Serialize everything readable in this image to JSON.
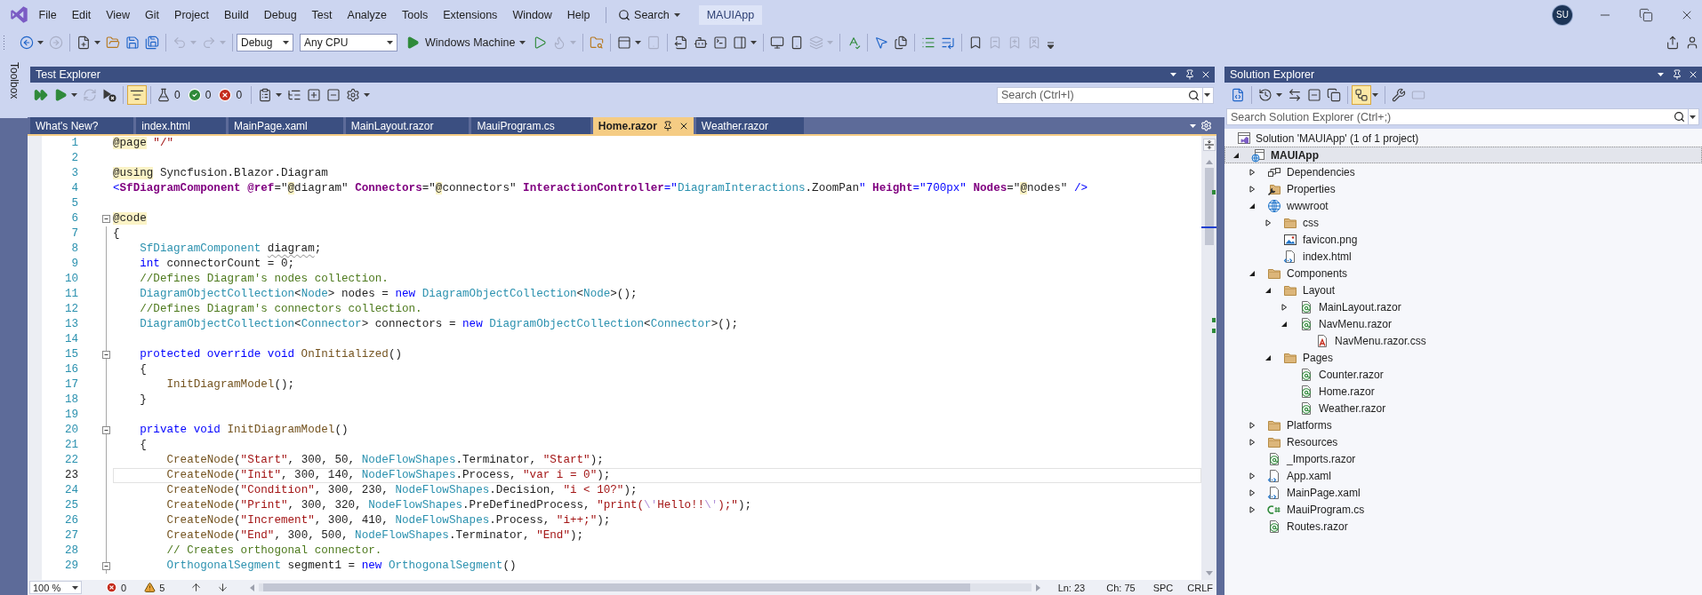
{
  "menu_bar": {
    "items": [
      "File",
      "Edit",
      "View",
      "Git",
      "Project",
      "Build",
      "Debug",
      "Test",
      "Analyze",
      "Tools",
      "Extensions",
      "Window",
      "Help"
    ],
    "search": "Search",
    "solution_name": "MAUIApp",
    "account_initials": "SU"
  },
  "main_toolbar": {
    "items": [
      {
        "kind": "icon",
        "disabled": false
      },
      {
        "kind": "icon",
        "disabled": true
      },
      {
        "kind": "separator"
      },
      {
        "kind": "icon",
        "disabled": false
      },
      {
        "kind": "icon",
        "disabled": false
      },
      {
        "kind": "icon",
        "disabled": false
      },
      {
        "kind": "icon",
        "disabled": false
      },
      {
        "kind": "separator"
      },
      {
        "kind": "icon",
        "disabled": true
      },
      {
        "kind": "icon",
        "disabled": true
      },
      {
        "kind": "separator"
      },
      {
        "kind": "select",
        "value": "Debug"
      },
      {
        "kind": "select",
        "value": "Any CPU"
      },
      {
        "kind": "launch",
        "label": "Windows Machine"
      },
      {
        "kind": "icon",
        "disabled": false
      },
      {
        "kind": "icon",
        "disabled": true
      },
      {
        "kind": "separator"
      },
      {
        "kind": "icon",
        "disabled": false
      },
      {
        "kind": "separator"
      },
      {
        "kind": "icon",
        "disabled": false
      },
      {
        "kind": "icon",
        "disabled": true
      },
      {
        "kind": "separator"
      },
      {
        "kind": "icon",
        "disabled": false
      },
      {
        "kind": "icon",
        "disabled": false
      },
      {
        "kind": "icon",
        "disabled": false
      },
      {
        "kind": "icon",
        "disabled": false
      },
      {
        "kind": "separator"
      },
      {
        "kind": "icon",
        "disabled": false
      },
      {
        "kind": "icon",
        "disabled": false
      },
      {
        "kind": "icon",
        "disabled": true
      },
      {
        "kind": "separator"
      },
      {
        "kind": "icon",
        "disabled": false
      },
      {
        "kind": "separator"
      },
      {
        "kind": "icon",
        "disabled": false
      },
      {
        "kind": "icon",
        "disabled": false
      },
      {
        "kind": "separator"
      },
      {
        "kind": "icon",
        "disabled": false
      },
      {
        "kind": "icon",
        "disabled": false
      },
      {
        "kind": "separator"
      },
      {
        "kind": "icon",
        "disabled": false
      },
      {
        "kind": "icon",
        "disabled": true
      },
      {
        "kind": "icon",
        "disabled": true
      },
      {
        "kind": "icon",
        "disabled": true
      }
    ],
    "right_items": [
      {
        "kind": "icon",
        "disabled": false
      },
      {
        "kind": "icon",
        "disabled": false
      }
    ]
  },
  "toolbox_tab": {
    "label": "Toolbox"
  },
  "test_explorer": {
    "title": "Test Explorer",
    "toolbar": [
      {
        "kind": "icon",
        "disabled": false,
        "on": false
      },
      {
        "kind": "icon",
        "disabled": false,
        "on": false
      },
      {
        "kind": "icon",
        "disabled": true,
        "on": false
      },
      {
        "kind": "icon",
        "disabled": false,
        "on": false
      },
      {
        "kind": "separator"
      },
      {
        "kind": "icon",
        "disabled": false,
        "on": true
      },
      {
        "kind": "separator"
      },
      {
        "kind": "counter",
        "value": "0"
      },
      {
        "kind": "counter",
        "value": "0"
      },
      {
        "kind": "counter",
        "value": "0"
      },
      {
        "kind": "separator"
      },
      {
        "kind": "icon",
        "disabled": false,
        "on": false
      },
      {
        "kind": "icon",
        "disabled": false,
        "on": false
      },
      {
        "kind": "icon",
        "disabled": false,
        "on": false
      },
      {
        "kind": "icon",
        "disabled": false,
        "on": false
      },
      {
        "kind": "icon",
        "disabled": false,
        "on": false
      }
    ],
    "search": {
      "placeholder": "Search (Ctrl+I)"
    }
  },
  "editor": {
    "tabs": [
      {
        "label": "What's New?",
        "selected": false
      },
      {
        "label": "index.html",
        "selected": false
      },
      {
        "label": "MainPage.xaml",
        "selected": false
      },
      {
        "label": "MainLayout.razor",
        "selected": false
      },
      {
        "label": "MauiProgram.cs",
        "selected": false
      },
      {
        "label": "Home.razor",
        "selected": true
      },
      {
        "label": "Weather.razor",
        "selected": false
      }
    ],
    "lines": [
      {
        "number": "1",
        "selected": false,
        "tokens": [
          {
            "kind": "razor",
            "text": "@page"
          },
          {
            "kind": "string",
            "text": " \"/\""
          }
        ]
      },
      {
        "number": "2",
        "selected": false
      },
      {
        "number": "3",
        "selected": false,
        "tokens": [
          {
            "kind": "razor",
            "text": "@using"
          },
          {
            "kind": "plain",
            "text": " Syncfusion.Blazor.Diagram"
          }
        ]
      },
      {
        "number": "4",
        "selected": false,
        "tokens": [
          {
            "kind": "punct",
            "text": "<"
          },
          {
            "kind": "markup",
            "text": "SfDiagramComponent"
          },
          {
            "kind": "markup",
            "text": " @ref"
          },
          {
            "kind": "plain",
            "text": "=\""
          },
          {
            "kind": "razor",
            "text": "@"
          },
          {
            "kind": "plain",
            "text": "diagram\" "
          },
          {
            "kind": "markup",
            "text": "Connectors"
          },
          {
            "kind": "plain",
            "text": "=\""
          },
          {
            "kind": "razor",
            "text": "@"
          },
          {
            "kind": "plain",
            "text": "connectors\" "
          },
          {
            "kind": "markup",
            "text": "InteractionController"
          },
          {
            "kind": "punct",
            "text": "=\""
          },
          {
            "kind": "type",
            "text": "DiagramInteractions"
          },
          {
            "kind": "plain",
            "text": ".ZoomPan"
          },
          {
            "kind": "punct",
            "text": "\""
          },
          {
            "kind": "markup",
            "text": " Height"
          },
          {
            "kind": "punct",
            "text": "=\"700px\""
          },
          {
            "kind": "markup",
            "text": " Nodes"
          },
          {
            "kind": "plain",
            "text": "=\""
          },
          {
            "kind": "razor",
            "text": "@"
          },
          {
            "kind": "plain",
            "text": "nodes\""
          },
          {
            "kind": "punct",
            "text": " />"
          }
        ]
      },
      {
        "number": "5",
        "selected": false
      },
      {
        "number": "6",
        "selected": false,
        "expanded": true,
        "tokens": [
          {
            "kind": "razor",
            "text": "@code"
          }
        ]
      },
      {
        "number": "7",
        "selected": false,
        "tokens": [
          {
            "kind": "plain",
            "text": "{"
          }
        ]
      },
      {
        "number": "8",
        "selected": false,
        "tokens": [
          {
            "kind": "type",
            "text": "    SfDiagramComponent "
          },
          {
            "kind": "flagged",
            "text": "diagram"
          },
          {
            "kind": "plain",
            "text": ";"
          }
        ]
      },
      {
        "number": "9",
        "selected": false,
        "tokens": [
          {
            "kind": "keyword",
            "text": "    int"
          },
          {
            "kind": "plain",
            "text": " connectorCount = 0;"
          }
        ]
      },
      {
        "number": "10",
        "selected": false,
        "tokens": [
          {
            "kind": "comment",
            "text": "    //Defines Diagram's nodes collection."
          }
        ]
      },
      {
        "number": "11",
        "selected": false,
        "tokens": [
          {
            "kind": "type",
            "text": "    DiagramObjectCollection"
          },
          {
            "kind": "plain",
            "text": "<"
          },
          {
            "kind": "type",
            "text": "Node"
          },
          {
            "kind": "plain",
            "text": "> nodes = "
          },
          {
            "kind": "keyword",
            "text": "new"
          },
          {
            "kind": "type",
            "text": " DiagramObjectCollection"
          },
          {
            "kind": "plain",
            "text": "<"
          },
          {
            "kind": "type",
            "text": "Node"
          },
          {
            "kind": "plain",
            "text": ">();"
          }
        ]
      },
      {
        "number": "12",
        "selected": false,
        "tokens": [
          {
            "kind": "comment",
            "text": "    //Defines Diagram's connectors collection."
          }
        ]
      },
      {
        "number": "13",
        "selected": false,
        "tokens": [
          {
            "kind": "type",
            "text": "    DiagramObjectCollection"
          },
          {
            "kind": "plain",
            "text": "<"
          },
          {
            "kind": "type",
            "text": "Connector"
          },
          {
            "kind": "plain",
            "text": "> connectors = "
          },
          {
            "kind": "keyword",
            "text": "new"
          },
          {
            "kind": "type",
            "text": " DiagramObjectCollection"
          },
          {
            "kind": "plain",
            "text": "<"
          },
          {
            "kind": "type",
            "text": "Connector"
          },
          {
            "kind": "plain",
            "text": ">();"
          }
        ]
      },
      {
        "number": "14",
        "selected": false
      },
      {
        "number": "15",
        "selected": false,
        "expanded": true,
        "tokens": [
          {
            "kind": "keyword",
            "text": "    protected override void"
          },
          {
            "kind": "method",
            "text": " OnInitialized"
          },
          {
            "kind": "plain",
            "text": "()"
          }
        ]
      },
      {
        "number": "16",
        "selected": false,
        "tokens": [
          {
            "kind": "plain",
            "text": "    {"
          }
        ]
      },
      {
        "number": "17",
        "selected": false,
        "tokens": [
          {
            "kind": "method",
            "text": "        InitDiagramModel"
          },
          {
            "kind": "plain",
            "text": "();"
          }
        ]
      },
      {
        "number": "18",
        "selected": false,
        "tokens": [
          {
            "kind": "plain",
            "text": "    }"
          }
        ]
      },
      {
        "number": "19",
        "selected": false
      },
      {
        "number": "20",
        "selected": false,
        "expanded": true,
        "tokens": [
          {
            "kind": "keyword",
            "text": "    private void"
          },
          {
            "kind": "method",
            "text": " InitDiagramModel"
          },
          {
            "kind": "plain",
            "text": "()"
          }
        ]
      },
      {
        "number": "21",
        "selected": false,
        "tokens": [
          {
            "kind": "plain",
            "text": "    {"
          }
        ]
      },
      {
        "number": "22",
        "selected": false,
        "tokens": [
          {
            "kind": "method",
            "text": "        CreateNode"
          },
          {
            "kind": "plain",
            "text": "("
          },
          {
            "kind": "string",
            "text": "\"Start\""
          },
          {
            "kind": "plain",
            "text": ", 300, 50, "
          },
          {
            "kind": "type",
            "text": "NodeFlowShapes"
          },
          {
            "kind": "plain",
            "text": ".Terminator, "
          },
          {
            "kind": "string",
            "text": "\"Start\""
          },
          {
            "kind": "plain",
            "text": ");"
          }
        ]
      },
      {
        "number": "23",
        "selected": true,
        "tokens": [
          {
            "kind": "method",
            "text": "        CreateNode"
          },
          {
            "kind": "plain",
            "text": "("
          },
          {
            "kind": "string",
            "text": "\"Init\""
          },
          {
            "kind": "plain",
            "text": ", 300, 140, "
          },
          {
            "kind": "type",
            "text": "NodeFlowShapes"
          },
          {
            "kind": "plain",
            "text": ".Process, "
          },
          {
            "kind": "string",
            "text": "\"var i = 0\""
          },
          {
            "kind": "plain",
            "text": ");"
          }
        ]
      },
      {
        "number": "24",
        "selected": false,
        "tokens": [
          {
            "kind": "method",
            "text": "        CreateNode"
          },
          {
            "kind": "plain",
            "text": "("
          },
          {
            "kind": "string",
            "text": "\"Condition\""
          },
          {
            "kind": "plain",
            "text": ", 300, 230, "
          },
          {
            "kind": "type",
            "text": "NodeFlowShapes"
          },
          {
            "kind": "plain",
            "text": ".Decision, "
          },
          {
            "kind": "string",
            "text": "\"i < 10?\""
          },
          {
            "kind": "plain",
            "text": ");"
          }
        ]
      },
      {
        "number": "25",
        "selected": false,
        "tokens": [
          {
            "kind": "method",
            "text": "        CreateNode"
          },
          {
            "kind": "plain",
            "text": "("
          },
          {
            "kind": "string",
            "text": "\"Print\""
          },
          {
            "kind": "plain",
            "text": ", 300, 320, "
          },
          {
            "kind": "type",
            "text": "NodeFlowShapes"
          },
          {
            "kind": "plain",
            "text": ".PreDefinedProcess, "
          },
          {
            "kind": "string",
            "text": "\"print("
          },
          {
            "kind": "escape",
            "text": "\\'"
          },
          {
            "kind": "string",
            "text": "Hello!!"
          },
          {
            "kind": "escape",
            "text": "\\'"
          },
          {
            "kind": "string",
            "text": ");\""
          },
          {
            "kind": "plain",
            "text": ");"
          }
        ]
      },
      {
        "number": "26",
        "selected": false,
        "tokens": [
          {
            "kind": "method",
            "text": "        CreateNode"
          },
          {
            "kind": "plain",
            "text": "("
          },
          {
            "kind": "string",
            "text": "\"Increment\""
          },
          {
            "kind": "plain",
            "text": ", 300, 410, "
          },
          {
            "kind": "type",
            "text": "NodeFlowShapes"
          },
          {
            "kind": "plain",
            "text": ".Process, "
          },
          {
            "kind": "string",
            "text": "\"i++;\""
          },
          {
            "kind": "plain",
            "text": ");"
          }
        ]
      },
      {
        "number": "27",
        "selected": false,
        "tokens": [
          {
            "kind": "method",
            "text": "        CreateNode"
          },
          {
            "kind": "plain",
            "text": "("
          },
          {
            "kind": "string",
            "text": "\"End\""
          },
          {
            "kind": "plain",
            "text": ", 300, 500, "
          },
          {
            "kind": "type",
            "text": "NodeFlowShapes"
          },
          {
            "kind": "plain",
            "text": ".Terminator, "
          },
          {
            "kind": "string",
            "text": "\"End\""
          },
          {
            "kind": "plain",
            "text": ");"
          }
        ]
      },
      {
        "number": "28",
        "selected": false,
        "tokens": [
          {
            "kind": "comment",
            "text": "        // Creates orthogonal connector."
          }
        ]
      },
      {
        "number": "29",
        "selected": false,
        "expanded": true,
        "tokens": [
          {
            "kind": "type",
            "text": "        OrthogonalSegment"
          },
          {
            "kind": "plain",
            "text": " segment1 = "
          },
          {
            "kind": "keyword",
            "text": "new"
          },
          {
            "kind": "type",
            "text": " OrthogonalSegment"
          },
          {
            "kind": "plain",
            "text": "()"
          }
        ]
      }
    ],
    "status": {
      "zoom": "100 %",
      "errors": "0",
      "warnings": "5",
      "line": "Ln: 23",
      "column": "Ch: 75",
      "whitespace": "SPC",
      "line_ending": "CRLF"
    }
  },
  "solution_explorer": {
    "title": "Solution Explorer",
    "toolbar": [
      {
        "kind": "icon",
        "disabled": false,
        "on": false
      },
      {
        "kind": "separator"
      },
      {
        "kind": "icon",
        "disabled": false,
        "on": false
      },
      {
        "kind": "icon",
        "disabled": false,
        "on": false
      },
      {
        "kind": "icon",
        "disabled": false,
        "on": false
      },
      {
        "kind": "icon",
        "disabled": false,
        "on": false
      },
      {
        "kind": "separator"
      },
      {
        "kind": "icon",
        "disabled": false,
        "on": true
      },
      {
        "kind": "separator"
      },
      {
        "kind": "icon",
        "disabled": false,
        "on": false
      },
      {
        "kind": "icon",
        "disabled": true,
        "on": false
      }
    ],
    "search": {
      "placeholder": "Search Solution Explorer (Ctrl+;)"
    },
    "tree": {
      "kind": "solution",
      "label": "Solution 'MAUIApp' (1 of 1 project)",
      "selected": false,
      "children": [
        {
          "kind": "project",
          "label": "MAUIApp",
          "expanded": true,
          "selected": true,
          "children": [
            {
              "kind": "dependencies",
              "label": "Dependencies",
              "expanded": false,
              "selected": false
            },
            {
              "kind": "properties",
              "label": "Properties",
              "expanded": false,
              "selected": false
            },
            {
              "kind": "web",
              "label": "wwwroot",
              "expanded": true,
              "selected": false,
              "children": [
                {
                  "kind": "folder",
                  "label": "css",
                  "expanded": false,
                  "selected": false
                },
                {
                  "kind": "image",
                  "label": "favicon.png",
                  "selected": false
                },
                {
                  "kind": "html",
                  "label": "index.html",
                  "selected": false
                }
              ]
            },
            {
              "kind": "folder",
              "label": "Components",
              "expanded": true,
              "selected": false,
              "children": [
                {
                  "kind": "folder",
                  "label": "Layout",
                  "expanded": true,
                  "selected": false,
                  "children": [
                    {
                      "kind": "razor",
                      "label": "MainLayout.razor",
                      "expanded": false,
                      "selected": false
                    },
                    {
                      "kind": "razor",
                      "label": "NavMenu.razor",
                      "expanded": true,
                      "selected": false,
                      "children": [
                        {
                          "kind": "css",
                          "label": "NavMenu.razor.css",
                          "selected": false
                        }
                      ]
                    }
                  ]
                },
                {
                  "kind": "folder",
                  "label": "Pages",
                  "expanded": true,
                  "selected": false,
                  "children": [
                    {
                      "kind": "razor",
                      "label": "Counter.razor",
                      "selected": false
                    },
                    {
                      "kind": "razor",
                      "label": "Home.razor",
                      "selected": false
                    },
                    {
                      "kind": "razor",
                      "label": "Weather.razor",
                      "selected": false
                    }
                  ]
                }
              ]
            },
            {
              "kind": "folder",
              "label": "Platforms",
              "expanded": false,
              "selected": false
            },
            {
              "kind": "folder",
              "label": "Resources",
              "expanded": false,
              "selected": false
            },
            {
              "kind": "razor",
              "label": "_Imports.razor",
              "selected": false
            },
            {
              "kind": "xaml",
              "label": "App.xaml",
              "expanded": false,
              "selected": false
            },
            {
              "kind": "xaml",
              "label": "MainPage.xaml",
              "expanded": false,
              "selected": false
            },
            {
              "kind": "csharp",
              "label": "MauiProgram.cs",
              "expanded": false,
              "selected": false
            },
            {
              "kind": "razor",
              "label": "Routes.razor",
              "selected": false
            }
          ]
        }
      ]
    }
  }
}
